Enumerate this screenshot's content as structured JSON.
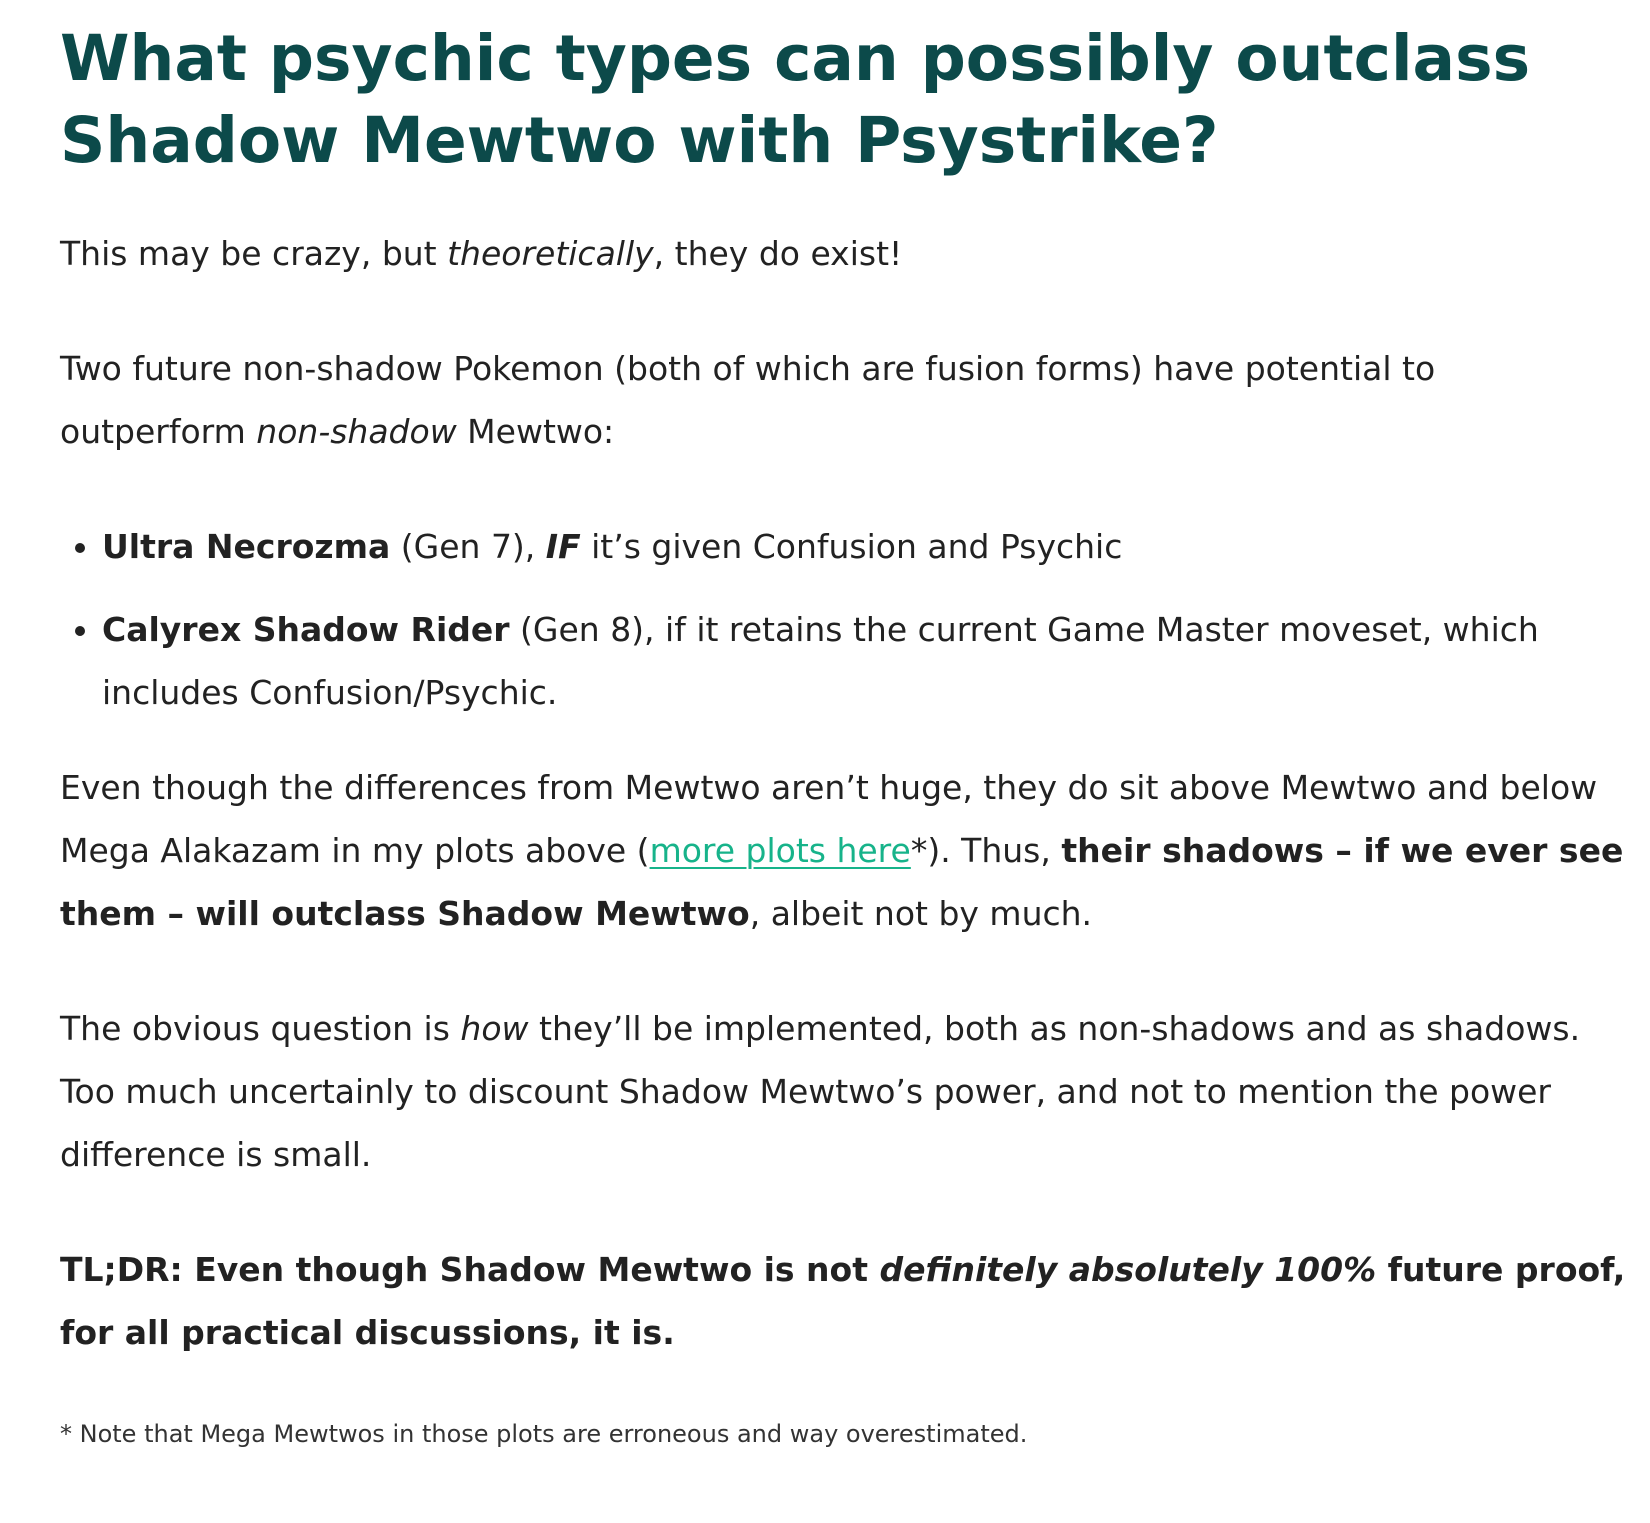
{
  "article": {
    "title": "What psychic types can possibly outclass Shadow Mewtwo with Psystrike?",
    "p1": {
      "a": "This may be crazy, but ",
      "em": "theoretically",
      "b": ", they do exist!"
    },
    "p2": {
      "a": "Two future non-shadow Pokemon (both of which are fusion forms) have potential to outperform ",
      "em": "non-shadow",
      "b": " Mewtwo:"
    },
    "list": [
      {
        "name": "Ultra Necrozma",
        "a": " (Gen 7), ",
        "em": "IF",
        "b": " it’s given Confusion and Psychic"
      },
      {
        "name": "Calyrex Shadow Rider",
        "a": " (Gen 8), if it retains the current Game Master moveset, which includes Confusion/Psychic."
      }
    ],
    "p3": {
      "a": "Even though the differences from Mewtwo aren’t huge, they do sit above Mewtwo and below Mega Alakazam in my plots above (",
      "link": "more plots here",
      "b": "*). Thus, ",
      "strong": "their shadows – if we ever see them – will outclass Shadow Mewtwo",
      "c": ", albeit not by much."
    },
    "p4": {
      "a": "The obvious question is ",
      "em": "how",
      "b": " they’ll be implemented, both as non-shadows and as shadows. Too much uncertainly to discount Shadow Mewtwo’s power, and not to mention the power difference is small."
    },
    "tldr": {
      "a": "TL;DR: Even though Shadow Mewtwo is not ",
      "em": "definitely absolutely 100%",
      "b": " future proof, for all practical discussions, it is."
    },
    "note": "* Note that Mega Mewtwos in those plots are erroneous and way overestimated."
  },
  "colors": {
    "title": "#0c4a4a",
    "link": "#17b38a",
    "text": "#222222"
  }
}
